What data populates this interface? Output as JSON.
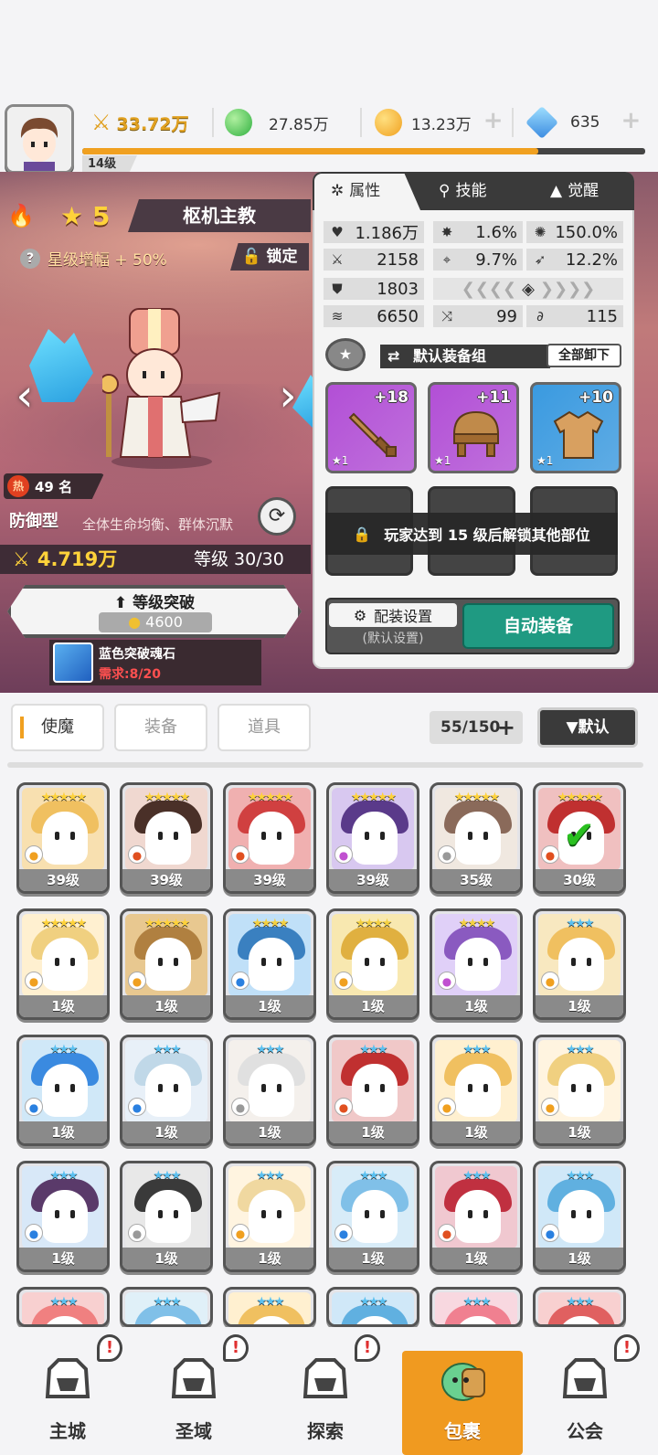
{
  "player": {
    "level": "14级",
    "xp_fraction": 0.81
  },
  "resources": {
    "power": "33.72万",
    "green_gem": "27.85万",
    "gold": "13.23万",
    "diamond": "635"
  },
  "hero": {
    "star": "5",
    "name": "枢机主教",
    "star_bonus": "星级增幅 + 50%",
    "lock_label": "锁定",
    "hot_rank": "49 名",
    "hot_icon": "热",
    "type": "防御型",
    "type_desc": "全体生命均衡、群体沉默",
    "power": "4.719万",
    "level": "等级 30/30",
    "breakthrough_label": "等级突破",
    "breakthrough_cost": "4600",
    "stone_name": "蓝色突破魂石",
    "stone_req": "需求:8/20"
  },
  "panel": {
    "tabs": [
      "属性",
      "技能",
      "觉醒"
    ],
    "stats": {
      "hp": "1.186万",
      "crit": "1.6%",
      "crit_dmg": "150.0%",
      "atk": "2158",
      "hit": "9.7%",
      "dodge": "12.2%",
      "def": "1803",
      "speed": "6650",
      "s1": "99",
      "s2": "115"
    },
    "equip_group": "默认装备组",
    "unload_all": "全部卸下",
    "equip": [
      {
        "plus": "+18",
        "star": "★1",
        "color": "#b24fd6"
      },
      {
        "plus": "+11",
        "star": "★1",
        "color": "#b24fd6"
      },
      {
        "plus": "+10",
        "star": "★1",
        "color": "#3a9ae0"
      }
    ],
    "locked_msg": "玩家达到 15 级后解锁其他部位",
    "config_label": "配装设置",
    "config_sub": "(默认设置)",
    "auto_equip": "自动装备"
  },
  "list": {
    "tabs": [
      "使魔",
      "装备",
      "道具"
    ],
    "count": "55/150",
    "sort": "▼默认",
    "rows": [
      [
        {
          "stars": "★★★★★",
          "lv": "39级",
          "hair": "#f0c060",
          "bg": "#f8e0b0",
          "el": "#f0a020"
        },
        {
          "stars": "★★★★★",
          "lv": "39级",
          "hair": "#4a3028",
          "bg": "#f0d8d0",
          "el": "#e05020"
        },
        {
          "stars": "★★★★★",
          "lv": "39级",
          "hair": "#d04040",
          "bg": "#f0b0b0",
          "el": "#e05020"
        },
        {
          "stars": "★★★★★",
          "lv": "39级",
          "hair": "#5a3a8a",
          "bg": "#d8c8f0",
          "el": "#c050d0"
        },
        {
          "stars": "★★★★★",
          "lv": "35级",
          "hair": "#8a6a5a",
          "bg": "#f0e8e0",
          "el": "#999999"
        },
        {
          "stars": "★★★★★",
          "lv": "30级",
          "hair": "#c03030",
          "bg": "#f0c0c0",
          "el": "#e05020",
          "check": "✔"
        }
      ],
      [
        {
          "stars": "★★★★★",
          "lv": "1级",
          "hair": "#f0d080",
          "bg": "#fff0d0",
          "el": "#f0a020"
        },
        {
          "stars": "★★★★★",
          "lv": "1级",
          "hair": "#b08040",
          "bg": "#e8c890",
          "el": "#f0a020"
        },
        {
          "stars": "★★★★",
          "lv": "1级",
          "hair": "#3a80c0",
          "bg": "#c0e0f8",
          "el": "#2a80e0"
        },
        {
          "stars": "★★★★",
          "lv": "1级",
          "hair": "#e0b040",
          "bg": "#f8e8b0",
          "el": "#f0a020"
        },
        {
          "stars": "★★★★",
          "lv": "1级",
          "hair": "#8a5ac0",
          "bg": "#e0d0f8",
          "el": "#c050d0"
        },
        {
          "stars": "★★★",
          "lv": "1级",
          "hair": "#f0c060",
          "bg": "#f8e8c0",
          "el": "#f0a020"
        }
      ],
      [
        {
          "stars": "★★★",
          "lv": "1级",
          "hair": "#3a8ae0",
          "bg": "#d0e8f8",
          "el": "#2a80e0"
        },
        {
          "stars": "★★★",
          "lv": "1级",
          "hair": "#c0d8e8",
          "bg": "#e8f0f8",
          "el": "#2a80e0"
        },
        {
          "stars": "★★★",
          "lv": "1级",
          "hair": "#e0e0e0",
          "bg": "#f4f0ec",
          "el": "#999999"
        },
        {
          "stars": "★★★",
          "lv": "1级",
          "hair": "#c03030",
          "bg": "#f0c8c8",
          "el": "#e05020"
        },
        {
          "stars": "★★★",
          "lv": "1级",
          "hair": "#f0c060",
          "bg": "#fff0d0",
          "el": "#f0a020"
        },
        {
          "stars": "★★★",
          "lv": "1级",
          "hair": "#f0d080",
          "bg": "#fff4e0",
          "el": "#f0a020"
        }
      ],
      [
        {
          "stars": "★★★",
          "lv": "1级",
          "hair": "#5a3a6a",
          "bg": "#d8e8f8",
          "el": "#2a80e0"
        },
        {
          "stars": "★★★",
          "lv": "1级",
          "hair": "#3a3a3a",
          "bg": "#e8e8e8",
          "el": "#999999"
        },
        {
          "stars": "★★★",
          "lv": "1级",
          "hair": "#f0d8a0",
          "bg": "#fff4e0",
          "el": "#f0a020"
        },
        {
          "stars": "★★★",
          "lv": "1级",
          "hair": "#80c0e8",
          "bg": "#d8ecf8",
          "el": "#2a80e0"
        },
        {
          "stars": "★★★",
          "lv": "1级",
          "hair": "#c03040",
          "bg": "#f0c8d0",
          "el": "#e05020"
        },
        {
          "stars": "★★★",
          "lv": "1级",
          "hair": "#60b0e0",
          "bg": "#d0e8f8",
          "el": "#2a80e0"
        }
      ],
      [
        {
          "stars": "★★★",
          "lv": "",
          "hair": "#f08080",
          "bg": "#f8d0d0",
          "el": "#e05020"
        },
        {
          "stars": "★★★",
          "lv": "",
          "hair": "#80c0e8",
          "bg": "#e0f0f8",
          "el": "#2a80e0"
        },
        {
          "stars": "★★★",
          "lv": "",
          "hair": "#f0c060",
          "bg": "#fff0d0",
          "el": "#f0a020"
        },
        {
          "stars": "★★★",
          "lv": "",
          "hair": "#60b0e0",
          "bg": "#d0e8f8",
          "el": "#2a80e0"
        },
        {
          "stars": "★★★",
          "lv": "",
          "hair": "#f08090",
          "bg": "#f8d8e0",
          "el": "#e05020"
        },
        {
          "stars": "★★★",
          "lv": "",
          "hair": "#e06060",
          "bg": "#f8d0d0",
          "el": "#e05020"
        }
      ]
    ]
  },
  "nav": {
    "items": [
      {
        "label": "主城",
        "alert": "!"
      },
      {
        "label": "圣域",
        "alert": "!"
      },
      {
        "label": "探索",
        "alert": "!"
      },
      {
        "label": "包裹",
        "alert": ""
      },
      {
        "label": "公会",
        "alert": "!"
      }
    ]
  }
}
